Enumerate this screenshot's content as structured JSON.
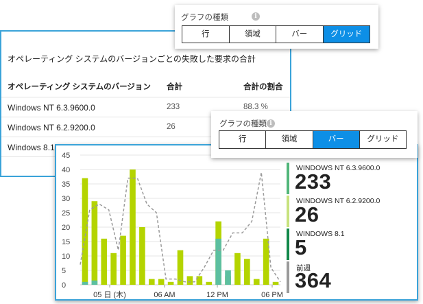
{
  "table": {
    "title": "オペレーティング システムのバージョンごとの失敗した要求の合計",
    "headers": [
      "オペレーティング システムのバージョン",
      "合計",
      "合計の割合"
    ],
    "rows": [
      {
        "os": "Windows NT 6.3.9600.0",
        "total": "233",
        "percent": "88.3 %"
      },
      {
        "os": "Windows NT 6.2.9200.0",
        "total": "26",
        "percent": ""
      },
      {
        "os": "Windows 8.1",
        "total": "",
        "percent": ""
      }
    ]
  },
  "selector_top": {
    "title": "グラフの種類",
    "options": [
      "行",
      "領域",
      "バー",
      "グリッド"
    ],
    "selected": "グリッド"
  },
  "selector_mid": {
    "title": "グラフの種類",
    "options": [
      "行",
      "領域",
      "バー",
      "グリッド"
    ],
    "selected": "バー"
  },
  "legend": [
    {
      "label": "WINDOWS NT 6.3.9600.0",
      "value": "233",
      "color": "#51b67a"
    },
    {
      "label": "WINDOWS NT 6.2.9200.0",
      "value": "26",
      "color": "#c7e27d"
    },
    {
      "label": "WINDOWS 8.1",
      "value": "5",
      "color": "#12884a"
    },
    {
      "label": "前週",
      "value": "364",
      "color": "#9a9a9a"
    }
  ],
  "colors": {
    "accent": "#3aa3d9",
    "selected_segment": "#0d8fe6",
    "bar_main": "#b4d400",
    "bar_secondary": "#5cbfa0",
    "previous_week_line": "#9a9a9a"
  },
  "chart_data": {
    "type": "bar",
    "ylim": [
      0,
      45
    ],
    "y_ticks": [
      "0",
      "5",
      "10",
      "15",
      "20",
      "25",
      "30",
      "35",
      "40",
      "45"
    ],
    "x_tick_labels": [
      "05 日 (木)",
      "06 AM",
      "12 PM",
      "06 PM"
    ],
    "series": [
      {
        "name": "WINDOWS NT 6.3.9600.0",
        "values": [
          37,
          29,
          16,
          11,
          17,
          40,
          20,
          2,
          2,
          1,
          12,
          3,
          3,
          1,
          22,
          3,
          11,
          9,
          2,
          16,
          1
        ]
      },
      {
        "name": "WINDOWS NT 6.2.9200.0",
        "values": [
          1,
          1.5,
          0,
          0,
          0,
          0,
          0,
          0,
          0,
          0,
          0,
          0,
          0,
          0,
          16,
          5,
          0,
          0,
          0,
          0,
          0
        ]
      }
    ],
    "previous_week_line": [
      7,
      26,
      28,
      26,
      12,
      37,
      37,
      28,
      25,
      2,
      2,
      1,
      1,
      6,
      12,
      12,
      18,
      18,
      22,
      39,
      6,
      1
    ]
  }
}
